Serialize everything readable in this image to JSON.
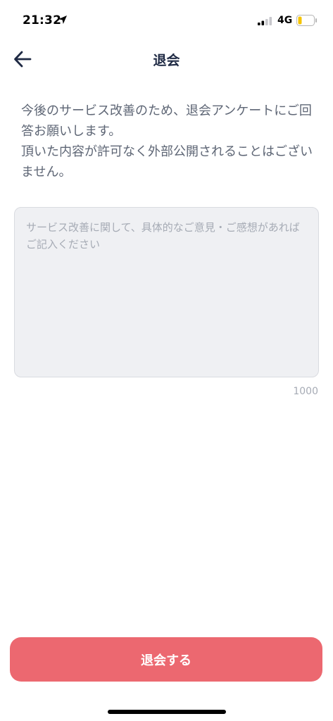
{
  "status_bar": {
    "time": "21:32",
    "network": "4G",
    "battery_color": "#f5c400"
  },
  "nav": {
    "title": "退会",
    "back_icon": "arrow-left-icon"
  },
  "description": "今後のサービス改善のため、退会アンケートにご回答お願いします。\n頂いた内容が許可なく外部公開されることはございません。",
  "feedback": {
    "placeholder": "サービス改善に関して、具体的なご意見・ご感想があればご記入ください",
    "value": "",
    "max_length": "1000"
  },
  "submit": {
    "label": "退会する",
    "color": "#ec6870"
  }
}
